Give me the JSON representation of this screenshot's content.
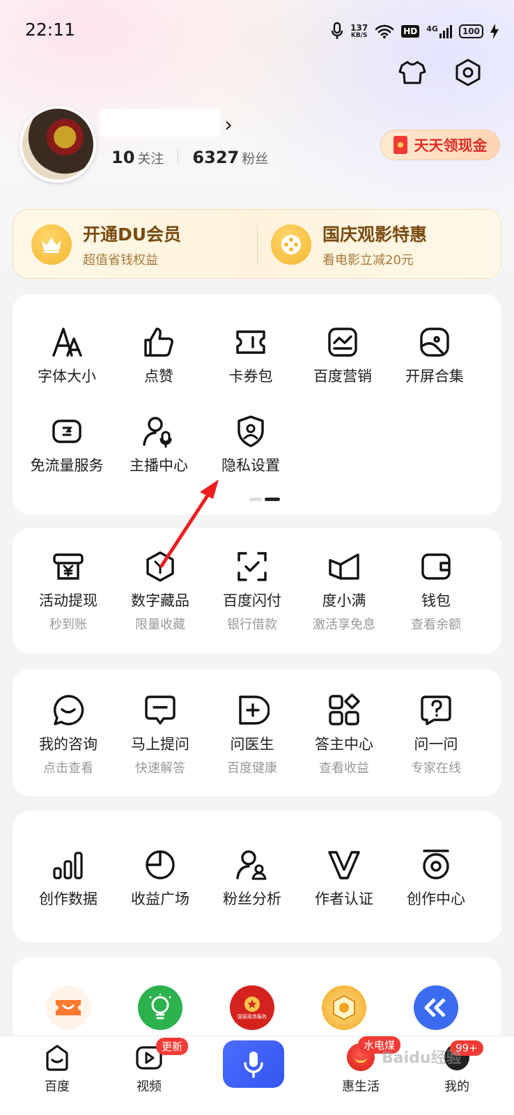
{
  "status_bar": {
    "time": "22:11",
    "net_speed_value": "137",
    "net_speed_unit": "KB/S",
    "hd": "HD",
    "network": "4G",
    "battery": "100"
  },
  "header": {
    "icons": [
      "shirt-icon",
      "settings-hexagon-icon"
    ]
  },
  "profile": {
    "follow_count": "10",
    "follow_label": "关注",
    "fans_count": "6327",
    "fans_label": "粉丝",
    "cash_button": "天天领现金"
  },
  "promo": {
    "left": {
      "title": "开通DU会员",
      "subtitle": "超值省钱权益"
    },
    "right": {
      "title": "国庆观影特惠",
      "subtitle": "看电影立减20元"
    }
  },
  "tools": {
    "items": [
      {
        "label": "字体大小",
        "icon": "font-size-icon"
      },
      {
        "label": "点赞",
        "icon": "thumbs-up-icon"
      },
      {
        "label": "卡券包",
        "icon": "ticket-icon"
      },
      {
        "label": "百度营销",
        "icon": "marketing-chart-icon"
      },
      {
        "label": "开屏合集",
        "icon": "splash-collection-icon"
      },
      {
        "label": "免流量服务",
        "icon": "free-data-icon"
      },
      {
        "label": "主播中心",
        "icon": "anchor-mic-icon"
      },
      {
        "label": "隐私设置",
        "icon": "privacy-shield-icon"
      }
    ]
  },
  "finance": {
    "items": [
      {
        "label": "活动提现",
        "sub": "秒到账",
        "icon": "withdraw-yen-icon"
      },
      {
        "label": "数字藏品",
        "sub": "限量收藏",
        "icon": "digital-collectible-icon"
      },
      {
        "label": "百度闪付",
        "sub": "银行借款",
        "icon": "flash-pay-icon"
      },
      {
        "label": "度小满",
        "sub": "激活享免息",
        "icon": "duxiaoman-icon"
      },
      {
        "label": "钱包",
        "sub": "查看余额",
        "icon": "wallet-icon"
      }
    ]
  },
  "consult": {
    "items": [
      {
        "label": "我的咨询",
        "sub": "点击查看",
        "icon": "consult-chat-icon"
      },
      {
        "label": "马上提问",
        "sub": "快速解答",
        "icon": "ask-question-icon"
      },
      {
        "label": "问医生",
        "sub": "百度健康",
        "icon": "doctor-plus-icon"
      },
      {
        "label": "答主中心",
        "sub": "查看收益",
        "icon": "answerer-grid-icon"
      },
      {
        "label": "问一问",
        "sub": "专家在线",
        "icon": "ask-expert-icon"
      }
    ]
  },
  "creator": {
    "items": [
      {
        "label": "创作数据",
        "icon": "bar-chart-icon"
      },
      {
        "label": "收益广场",
        "icon": "pie-chart-icon"
      },
      {
        "label": "粉丝分析",
        "icon": "fans-analysis-icon"
      },
      {
        "label": "作者认证",
        "icon": "author-verify-icon"
      },
      {
        "label": "创作中心",
        "icon": "creation-center-icon"
      }
    ]
  },
  "services": {
    "items": [
      {
        "icon": "coupon-app-icon",
        "color": "#ff7a2e"
      },
      {
        "icon": "lightbulb-app-icon",
        "color": "#2bb24c"
      },
      {
        "icon": "gov-service-app-icon",
        "color": "#d4231f",
        "text": "国家政务服务"
      },
      {
        "icon": "baidu-badge-app-icon",
        "color": "#f3a51f"
      },
      {
        "icon": "blue-chevron-app-icon",
        "color": "#3b6cf0"
      }
    ]
  },
  "bottom_nav": {
    "items": [
      {
        "label": "百度",
        "icon": "baidu-home-icon"
      },
      {
        "label": "视频",
        "icon": "video-play-icon",
        "badge": "更新"
      },
      {
        "label": "",
        "icon": "voice-mic-icon"
      },
      {
        "label": "惠生活",
        "icon": "hui-life-icon",
        "badge": "水电煤"
      },
      {
        "label": "我的",
        "icon": "my-profile-icon",
        "badge": "99+"
      }
    ]
  },
  "watermark": "Baidu经验"
}
